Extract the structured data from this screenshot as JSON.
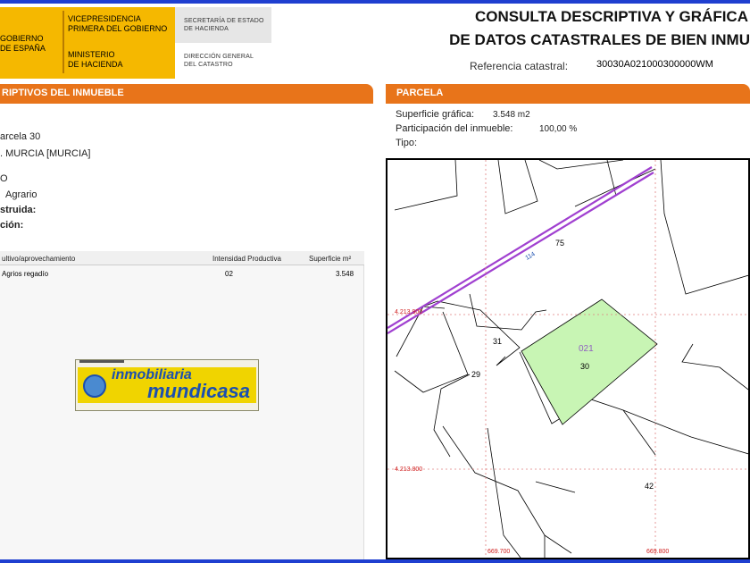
{
  "header": {
    "gov_left": [
      "GOBIERNO",
      "DE ESPAÑA"
    ],
    "gov_mid_top": [
      "VICEPRESIDENCIA",
      "PRIMERA DEL GOBIERNO"
    ],
    "gov_mid_bottom": [
      "MINISTERIO",
      "DE HACIENDA"
    ],
    "sec_top": [
      "SECRETARÍA DE ESTADO",
      "DE HACIENDA"
    ],
    "sec_bottom": [
      "DIRECCIÓN GENERAL",
      "DEL CATASTRO"
    ],
    "title_line1": "CONSULTA DESCRIPTIVA Y GRÁFICA",
    "title_line2": "DE DATOS CATASTRALES DE BIEN INMU",
    "ref_label": "Referencia catastral:",
    "ref_value": "30030A021000300000WM"
  },
  "left_section": {
    "bar_title": "RIPTIVOS DEL INMUEBLE",
    "address_line1": "arcela 30",
    "address_line2": ". MURCIA [MURCIA]",
    "zero": "O",
    "use_value": "Agrario",
    "truncated_label1": "struida:",
    "truncated_label2": "ción:",
    "table": {
      "headers": [
        "ultivo/aprovechamiento",
        "Intensidad Productiva",
        "Superficie m²"
      ],
      "row": [
        "Agrios regadío",
        "02",
        "3.548"
      ]
    },
    "watermark": {
      "word1": "inmobiliaria",
      "word2": "mundicasa"
    }
  },
  "right_section": {
    "bar_title": "PARCELA",
    "surface_label": "Superficie gráfica:",
    "surface_value": "3.548 m2",
    "participation_label": "Participación del inmueble:",
    "participation_value": "100,00 %",
    "type_label": "Tipo:",
    "map": {
      "parcel_numbers": [
        "75",
        "31",
        "29",
        "30",
        "42"
      ],
      "highlight_polygon": "021",
      "road_label": "114",
      "coord_y1": "4.213.900",
      "coord_y2": "4.213.800",
      "coord_x1": "669.700",
      "coord_x2": "669.800",
      "highlight_color": "#c8f5b4",
      "road_color": "#a040d0",
      "coord_color": "#d02020"
    }
  },
  "colors": {
    "section_bar": "#e8741a",
    "gov_yellow": "#f5b800",
    "frame_blue": "#1f3fd0"
  }
}
